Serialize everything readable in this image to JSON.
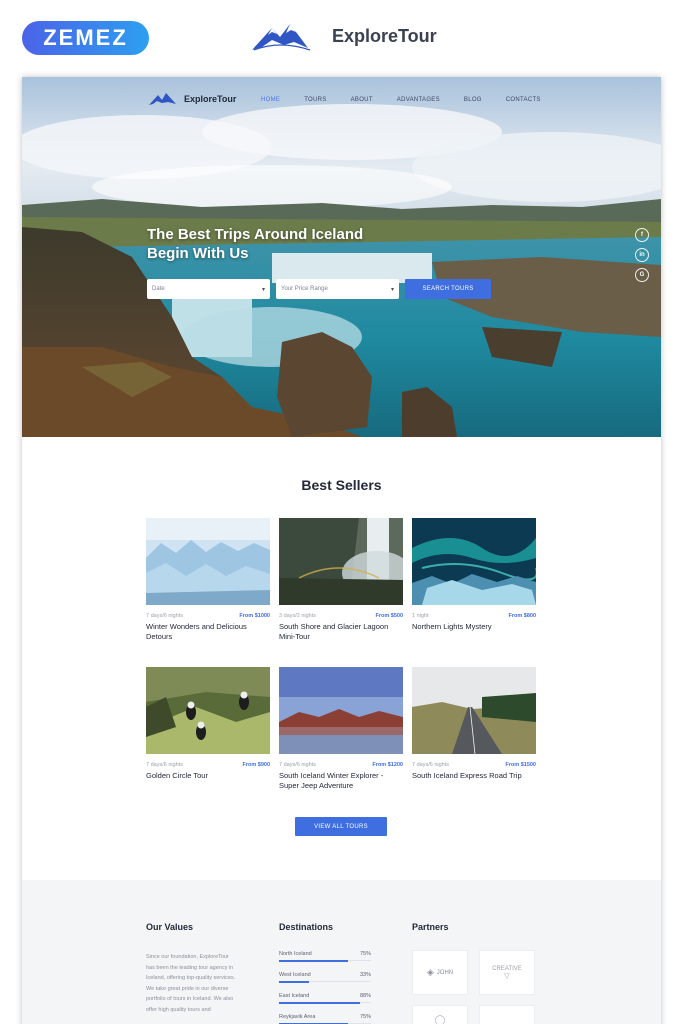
{
  "header": {
    "marketplace_logo": "ZEMEZ",
    "brand": "ExploreTour"
  },
  "site": {
    "logo_text": "ExploreTour",
    "nav": [
      "HOME",
      "TOURS",
      "ABOUT",
      "ADVANTAGES",
      "BLOG",
      "CONTACTS"
    ],
    "nav_active": "HOME",
    "hero": {
      "headline_1": "The Best Trips Around Iceland",
      "headline_2": "Begin With Us",
      "date_placeholder": "Date",
      "price_placeholder": "Your Price Range",
      "search_label": "SEARCH TOURS"
    },
    "social": [
      "f",
      "in",
      "G"
    ],
    "best_sellers": {
      "title": "Best Sellers",
      "tours": [
        {
          "duration": "7 days/6 nights",
          "price": "From $1000",
          "title": "Winter Wonders and Delicious Detours"
        },
        {
          "duration": "3 days/2 nights",
          "price": "From $500",
          "title": "South Shore and Glacier Lagoon Mini-Tour"
        },
        {
          "duration": "1 night",
          "price": "From $800",
          "title": "Northern Lights Mystery"
        },
        {
          "duration": "7 days/6 nights",
          "price": "From $900",
          "title": "Golden Circle Tour"
        },
        {
          "duration": "7 days/6 nights",
          "price": "From $1200",
          "title": "South Iceland Winter Explorer -Super Jeep Adventure"
        },
        {
          "duration": "7 days/6 nights",
          "price": "From $1500",
          "title": "South Iceland Express Road Trip"
        }
      ],
      "view_all": "VIEW ALL TOURS"
    },
    "footer": {
      "values_title": "Our Values",
      "values_text": "Since our foundation, ExploreTour has been the leading tour agency in Iceland, offering top-quality services. We take great pride in our diverse portfolio of tours in Iceland. We also offer high quality tours and",
      "destinations_title": "Destinations",
      "destinations": [
        {
          "name": "North Iceland",
          "percent": "75%",
          "level": 0.75
        },
        {
          "name": "West Iceland",
          "percent": "33%",
          "level": 0.33
        },
        {
          "name": "East Iceland",
          "percent": "88%",
          "level": 0.88
        },
        {
          "name": "Reykjavik Area",
          "percent": "75%",
          "level": 0.75
        }
      ],
      "partners_title": "Partners",
      "partners": [
        "JOHN",
        "CREATIVE"
      ]
    }
  },
  "colors": {
    "accent": "#3f6ee0",
    "zemez_start": "#4b63e8",
    "zemez_end": "#2d9ff0",
    "text_dark": "#23293a",
    "muted": "#9aa0ab",
    "footer_bg": "#f4f5f7"
  }
}
